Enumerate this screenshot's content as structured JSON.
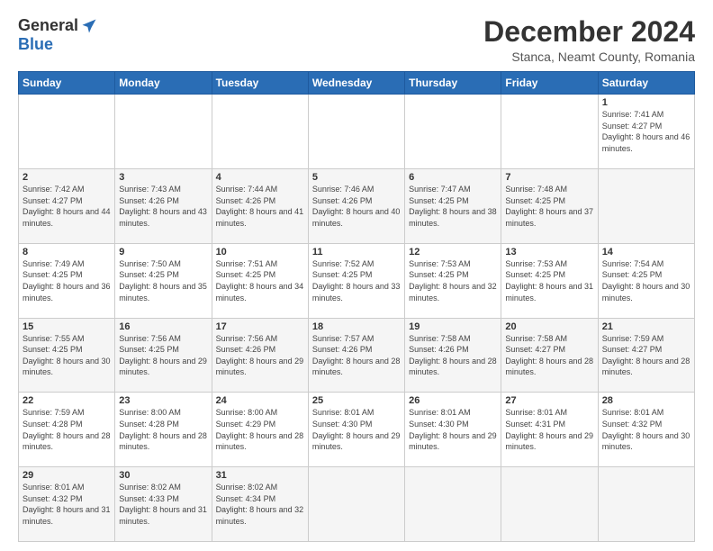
{
  "header": {
    "logo_general": "General",
    "logo_blue": "Blue",
    "main_title": "December 2024",
    "sub_title": "Stanca, Neamt County, Romania"
  },
  "calendar": {
    "days_of_week": [
      "Sunday",
      "Monday",
      "Tuesday",
      "Wednesday",
      "Thursday",
      "Friday",
      "Saturday"
    ],
    "weeks": [
      [
        null,
        null,
        null,
        null,
        null,
        null,
        {
          "day": 1,
          "sunrise": "7:41 AM",
          "sunset": "4:27 PM",
          "daylight": "8 hours and 46 minutes."
        }
      ],
      [
        {
          "day": 2,
          "sunrise": "7:42 AM",
          "sunset": "4:27 PM",
          "daylight": "8 hours and 44 minutes."
        },
        {
          "day": 3,
          "sunrise": "7:43 AM",
          "sunset": "4:26 PM",
          "daylight": "8 hours and 43 minutes."
        },
        {
          "day": 4,
          "sunrise": "7:44 AM",
          "sunset": "4:26 PM",
          "daylight": "8 hours and 41 minutes."
        },
        {
          "day": 5,
          "sunrise": "7:46 AM",
          "sunset": "4:26 PM",
          "daylight": "8 hours and 40 minutes."
        },
        {
          "day": 6,
          "sunrise": "7:47 AM",
          "sunset": "4:25 PM",
          "daylight": "8 hours and 38 minutes."
        },
        {
          "day": 7,
          "sunrise": "7:48 AM",
          "sunset": "4:25 PM",
          "daylight": "8 hours and 37 minutes."
        }
      ],
      [
        {
          "day": 8,
          "sunrise": "7:49 AM",
          "sunset": "4:25 PM",
          "daylight": "8 hours and 36 minutes."
        },
        {
          "day": 9,
          "sunrise": "7:50 AM",
          "sunset": "4:25 PM",
          "daylight": "8 hours and 35 minutes."
        },
        {
          "day": 10,
          "sunrise": "7:51 AM",
          "sunset": "4:25 PM",
          "daylight": "8 hours and 34 minutes."
        },
        {
          "day": 11,
          "sunrise": "7:52 AM",
          "sunset": "4:25 PM",
          "daylight": "8 hours and 33 minutes."
        },
        {
          "day": 12,
          "sunrise": "7:53 AM",
          "sunset": "4:25 PM",
          "daylight": "8 hours and 32 minutes."
        },
        {
          "day": 13,
          "sunrise": "7:53 AM",
          "sunset": "4:25 PM",
          "daylight": "8 hours and 31 minutes."
        },
        {
          "day": 14,
          "sunrise": "7:54 AM",
          "sunset": "4:25 PM",
          "daylight": "8 hours and 30 minutes."
        }
      ],
      [
        {
          "day": 15,
          "sunrise": "7:55 AM",
          "sunset": "4:25 PM",
          "daylight": "8 hours and 30 minutes."
        },
        {
          "day": 16,
          "sunrise": "7:56 AM",
          "sunset": "4:25 PM",
          "daylight": "8 hours and 29 minutes."
        },
        {
          "day": 17,
          "sunrise": "7:56 AM",
          "sunset": "4:26 PM",
          "daylight": "8 hours and 29 minutes."
        },
        {
          "day": 18,
          "sunrise": "7:57 AM",
          "sunset": "4:26 PM",
          "daylight": "8 hours and 28 minutes."
        },
        {
          "day": 19,
          "sunrise": "7:58 AM",
          "sunset": "4:26 PM",
          "daylight": "8 hours and 28 minutes."
        },
        {
          "day": 20,
          "sunrise": "7:58 AM",
          "sunset": "4:27 PM",
          "daylight": "8 hours and 28 minutes."
        },
        {
          "day": 21,
          "sunrise": "7:59 AM",
          "sunset": "4:27 PM",
          "daylight": "8 hours and 28 minutes."
        }
      ],
      [
        {
          "day": 22,
          "sunrise": "7:59 AM",
          "sunset": "4:28 PM",
          "daylight": "8 hours and 28 minutes."
        },
        {
          "day": 23,
          "sunrise": "8:00 AM",
          "sunset": "4:28 PM",
          "daylight": "8 hours and 28 minutes."
        },
        {
          "day": 24,
          "sunrise": "8:00 AM",
          "sunset": "4:29 PM",
          "daylight": "8 hours and 28 minutes."
        },
        {
          "day": 25,
          "sunrise": "8:01 AM",
          "sunset": "4:30 PM",
          "daylight": "8 hours and 29 minutes."
        },
        {
          "day": 26,
          "sunrise": "8:01 AM",
          "sunset": "4:30 PM",
          "daylight": "8 hours and 29 minutes."
        },
        {
          "day": 27,
          "sunrise": "8:01 AM",
          "sunset": "4:31 PM",
          "daylight": "8 hours and 29 minutes."
        },
        {
          "day": 28,
          "sunrise": "8:01 AM",
          "sunset": "4:32 PM",
          "daylight": "8 hours and 30 minutes."
        }
      ],
      [
        {
          "day": 29,
          "sunrise": "8:01 AM",
          "sunset": "4:32 PM",
          "daylight": "8 hours and 31 minutes."
        },
        {
          "day": 30,
          "sunrise": "8:02 AM",
          "sunset": "4:33 PM",
          "daylight": "8 hours and 31 minutes."
        },
        {
          "day": 31,
          "sunrise": "8:02 AM",
          "sunset": "4:34 PM",
          "daylight": "8 hours and 32 minutes."
        },
        null,
        null,
        null,
        null
      ]
    ]
  }
}
